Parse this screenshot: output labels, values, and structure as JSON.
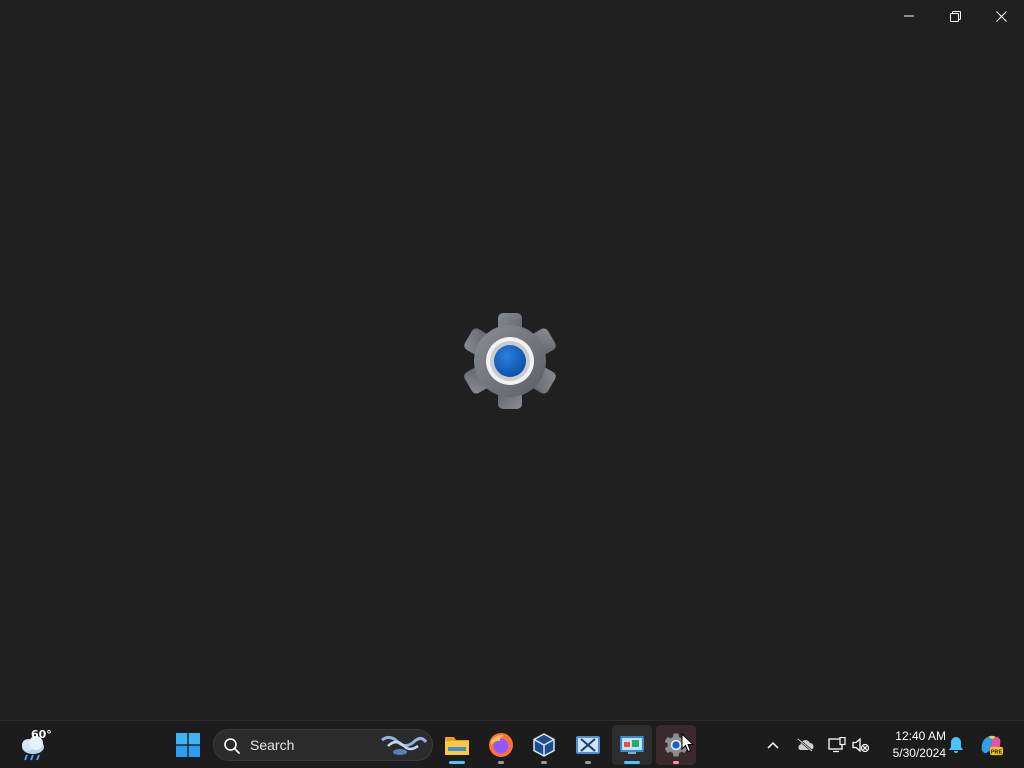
{
  "window": {
    "caption_buttons": [
      {
        "name": "minimize-button",
        "icon": "minimize-icon"
      },
      {
        "name": "restore-button",
        "icon": "restore-icon"
      },
      {
        "name": "close-button",
        "icon": "close-icon"
      }
    ],
    "splash_icon": "settings-gear-icon"
  },
  "taskbar": {
    "weather": {
      "temperature": "60°",
      "icon": "rainy-cloud-icon"
    },
    "search": {
      "label": "Search"
    },
    "apps": [
      {
        "name": "start",
        "icon": "windows-logo-icon"
      },
      {
        "name": "file-explorer",
        "icon": "folder-icon"
      },
      {
        "name": "firefox",
        "icon": "firefox-icon"
      },
      {
        "name": "virtualbox",
        "icon": "virtualbox-icon"
      },
      {
        "name": "snipping-tool",
        "icon": "scissors-icon"
      },
      {
        "name": "control-panel",
        "icon": "control-panel-icon"
      },
      {
        "name": "settings",
        "icon": "settings-gear-icon"
      }
    ],
    "tray": {
      "chevron": "chevron-up-icon",
      "onedrive": "cloud-off-icon",
      "network": "network-icon",
      "volume": "volume-muted-icon"
    },
    "clock": {
      "time": "12:40 AM",
      "date": "5/30/2024"
    },
    "notification_icon": "bell-icon",
    "copilot_badge": "PRE"
  },
  "colors": {
    "background": "#202020",
    "taskbar": "#1c1c1c",
    "accent": "#4cc2ff",
    "gear_blue": "#0f63c4"
  }
}
